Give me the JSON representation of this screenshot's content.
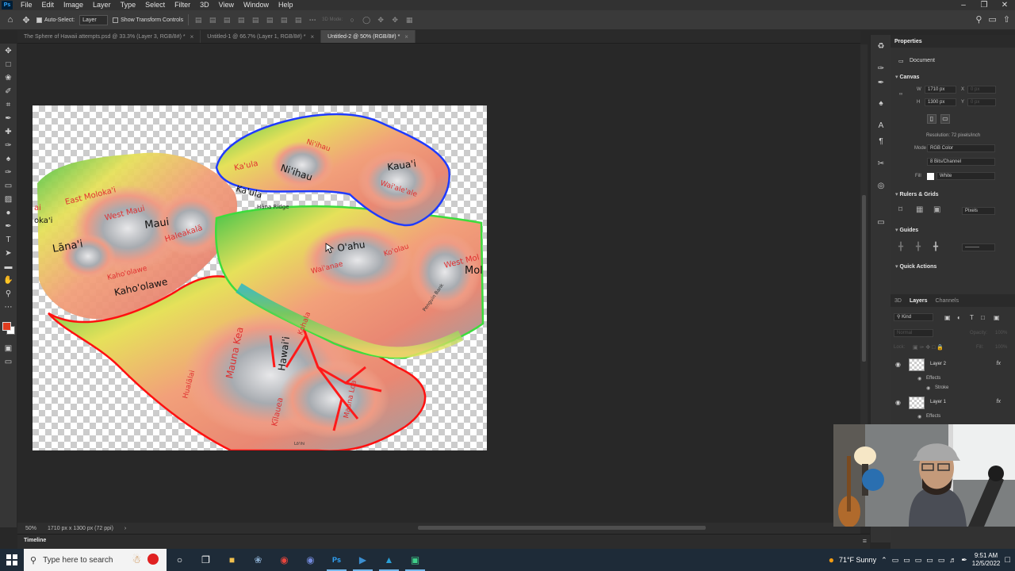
{
  "menubar": {
    "items": [
      "File",
      "Edit",
      "Image",
      "Layer",
      "Type",
      "Select",
      "Filter",
      "3D",
      "View",
      "Window",
      "Help"
    ],
    "app_icon": "Ps"
  },
  "optionsbar": {
    "auto_select_label": "Auto-Select:",
    "auto_select_target": "Layer",
    "transform_controls_label": "Show Transform Controls",
    "mode_3d_label": "3D Mode:"
  },
  "tabs": [
    {
      "title": "The Sphere of Hawaii attempts.psd @ 33.3% (Layer 3, RGB/8#) *",
      "active": false
    },
    {
      "title": "Untitled-1 @ 66.7% (Layer 1, RGB/8#) *",
      "active": false
    },
    {
      "title": "Untitled-2 @ 50% (RGB/8#) *",
      "active": true
    }
  ],
  "map_labels": {
    "kaula": "Ka'ula",
    "niihau": "Ni'ihau",
    "niihau_red": "Ni'ihau",
    "kauai": "Kaua'i",
    "waialeale": "Wai'ale'ale",
    "kaula2": "Ka'ula",
    "hana_ridge": "Hāna Ridge",
    "east_molokai": "East Moloka'i",
    "west_maui": "West Maui",
    "maui": "Maui",
    "haleakala": "Haleakalā",
    "lanai": "Lāna'i",
    "kahoolawe": "Kaho'olawe",
    "kahoolawe_red": "Kaho'olawe",
    "oahu": "O'ahu",
    "waianae": "Wai'anae",
    "koolau": "Ko'olau",
    "west_molokai": "West Mol",
    "molo": "Mol",
    "penguin_bank": "Penguin Bank",
    "mauna_kea": "Mauna Kea",
    "hawaii": "Hawai'i",
    "kohala": "Kohala",
    "hualalai": "Hualālai",
    "kilauea": "Kīlauea",
    "mauna_loa": "Mauna Loa",
    "loihi": "Lō'ihi",
    "oka": "oka'i",
    "pai": "ai"
  },
  "status": {
    "zoom": "50%",
    "doc_info": "1710 px x 1300 px (72 ppi)"
  },
  "timeline": {
    "label": "Timeline"
  },
  "properties": {
    "tab_label": "Properties",
    "document_label": "Document",
    "canvas_section": "Canvas",
    "width_label": "W",
    "width_value": "1710 px",
    "height_label": "H",
    "height_value": "1300 px",
    "x_label": "X",
    "x_placeholder": "0 px",
    "y_label": "Y",
    "y_placeholder": "0 px",
    "resolution": "Resolution: 72 pixels/inch",
    "mode_label": "Mode",
    "mode_value": "RGB Color",
    "bits_value": "8 Bits/Channel",
    "fill_label": "Fill",
    "fill_value": "White",
    "rulers_section": "Rulers & Grids",
    "ruler_units": "Pixels",
    "guides_section": "Guides",
    "quick_actions_section": "Quick Actions"
  },
  "layers_panel": {
    "tabs": [
      "3D",
      "Layers",
      "Channels"
    ],
    "active_tab": "Layers",
    "filter_kind": "Kind",
    "blend_mode": "Normal",
    "opacity_label": "Opacity:",
    "opacity_value": "100%",
    "lock_label": "Lock:",
    "fill_label": "Fill:",
    "fill_value": "100%",
    "layers": [
      {
        "name": "Layer 2",
        "effects_label": "Effects",
        "effect": "Stroke"
      },
      {
        "name": "Layer 1",
        "effects_label": "Effects"
      }
    ]
  },
  "taskbar": {
    "search_placeholder": "Type here to search",
    "weather": "71°F  Sunny",
    "time": "9:51 AM",
    "date": "12/5/2022"
  },
  "colors": {
    "accent_blue": "#31a8ff",
    "foreground_color": "#e03c1f",
    "background_color": "#ffffff",
    "selection_blue": "#1f3bff",
    "selection_green": "#3ddc3d",
    "selection_red": "#ff1010"
  }
}
